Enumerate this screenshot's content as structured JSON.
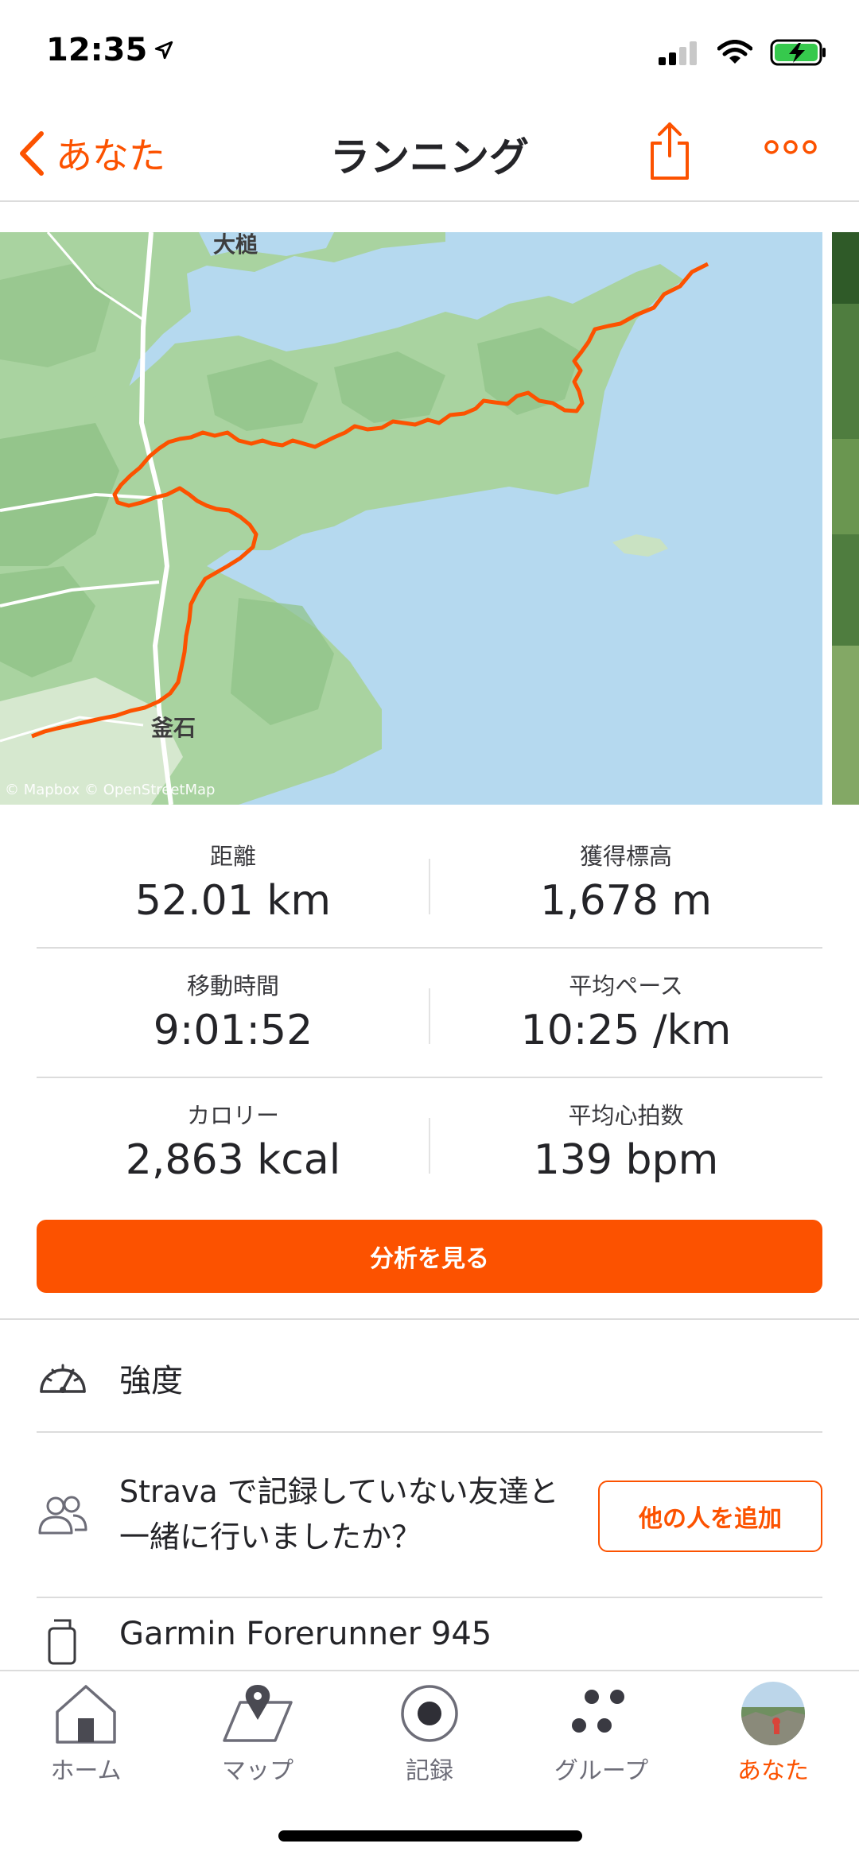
{
  "status_bar": {
    "time": "12:35"
  },
  "header": {
    "back_label": "あなた",
    "title": "ランニング"
  },
  "map": {
    "attribution": "© Mapbox © OpenStreetMap",
    "places": [
      "大槌",
      "釜石"
    ],
    "colors": {
      "water": "#b5d9ef",
      "land": "#a9d3a0",
      "route": "#fc5200"
    }
  },
  "stats": [
    {
      "label": "距離",
      "value": "52.01 km"
    },
    {
      "label": "獲得標高",
      "value": "1,678 m"
    },
    {
      "label": "移動時間",
      "value": "9:01:52"
    },
    {
      "label": "平均ペース",
      "value": "10:25 /km"
    },
    {
      "label": "カロリー",
      "value": "2,863 kcal"
    },
    {
      "label": "平均心拍数",
      "value": "139 bpm"
    }
  ],
  "analyze_button": "分析を見る",
  "intensity_label": "強度",
  "friends": {
    "text": "Strava で記録していない友達と一緒に行いましたか？",
    "button": "他の人を追加"
  },
  "device": "Garmin Forerunner 945",
  "tabs": [
    {
      "label": "ホーム",
      "icon": "home-icon"
    },
    {
      "label": "マップ",
      "icon": "map-icon"
    },
    {
      "label": "記録",
      "icon": "record-icon"
    },
    {
      "label": "グループ",
      "icon": "groups-icon"
    },
    {
      "label": "あなた",
      "icon": "avatar",
      "active": true
    }
  ],
  "accent_color": "#fc5200"
}
